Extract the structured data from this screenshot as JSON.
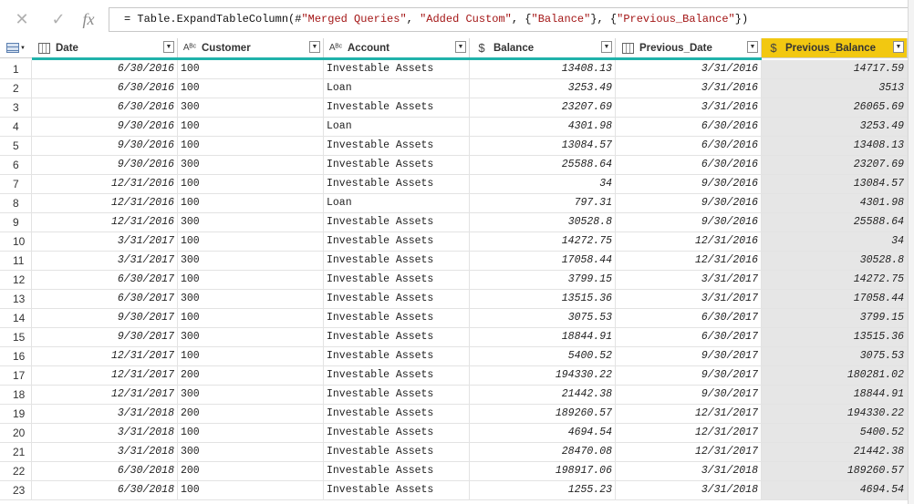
{
  "formula": {
    "prefix": "= Table.ExpandTableColumn(#",
    "arg1": "\"Merged Queries\"",
    "sep1": ", ",
    "arg2": "\"Added Custom\"",
    "sep2": ", {",
    "arg3": "\"Balance\"",
    "sep3": "}, {",
    "arg4": "\"Previous_Balance\"",
    "suffix": "})"
  },
  "columns": [
    {
      "label": "Date",
      "type_icon": "calendar-icon",
      "type_glyph": ""
    },
    {
      "label": "Customer",
      "type_icon": "text-type-icon",
      "type_glyph": "Aᴮᶜ"
    },
    {
      "label": "Account",
      "type_icon": "text-type-icon",
      "type_glyph": "Aᴮᶜ"
    },
    {
      "label": "Balance",
      "type_icon": "currency-icon",
      "type_glyph": "$"
    },
    {
      "label": "Previous_Date",
      "type_icon": "calendar-icon",
      "type_glyph": ""
    },
    {
      "label": "Previous_Balance",
      "type_icon": "currency-icon",
      "type_glyph": "$"
    }
  ],
  "rows": [
    [
      "1",
      "6/30/2016",
      "100",
      "Investable Assets",
      "13408.13",
      "3/31/2016",
      "14717.59"
    ],
    [
      "2",
      "6/30/2016",
      "100",
      "Loan",
      "3253.49",
      "3/31/2016",
      "3513"
    ],
    [
      "3",
      "6/30/2016",
      "300",
      "Investable Assets",
      "23207.69",
      "3/31/2016",
      "26065.69"
    ],
    [
      "4",
      "9/30/2016",
      "100",
      "Loan",
      "4301.98",
      "6/30/2016",
      "3253.49"
    ],
    [
      "5",
      "9/30/2016",
      "100",
      "Investable Assets",
      "13084.57",
      "6/30/2016",
      "13408.13"
    ],
    [
      "6",
      "9/30/2016",
      "300",
      "Investable Assets",
      "25588.64",
      "6/30/2016",
      "23207.69"
    ],
    [
      "7",
      "12/31/2016",
      "100",
      "Investable Assets",
      "34",
      "9/30/2016",
      "13084.57"
    ],
    [
      "8",
      "12/31/2016",
      "100",
      "Loan",
      "797.31",
      "9/30/2016",
      "4301.98"
    ],
    [
      "9",
      "12/31/2016",
      "300",
      "Investable Assets",
      "30528.8",
      "9/30/2016",
      "25588.64"
    ],
    [
      "10",
      "3/31/2017",
      "100",
      "Investable Assets",
      "14272.75",
      "12/31/2016",
      "34"
    ],
    [
      "11",
      "3/31/2017",
      "300",
      "Investable Assets",
      "17058.44",
      "12/31/2016",
      "30528.8"
    ],
    [
      "12",
      "6/30/2017",
      "100",
      "Investable Assets",
      "3799.15",
      "3/31/2017",
      "14272.75"
    ],
    [
      "13",
      "6/30/2017",
      "300",
      "Investable Assets",
      "13515.36",
      "3/31/2017",
      "17058.44"
    ],
    [
      "14",
      "9/30/2017",
      "100",
      "Investable Assets",
      "3075.53",
      "6/30/2017",
      "3799.15"
    ],
    [
      "15",
      "9/30/2017",
      "300",
      "Investable Assets",
      "18844.91",
      "6/30/2017",
      "13515.36"
    ],
    [
      "16",
      "12/31/2017",
      "100",
      "Investable Assets",
      "5400.52",
      "9/30/2017",
      "3075.53"
    ],
    [
      "17",
      "12/31/2017",
      "200",
      "Investable Assets",
      "194330.22",
      "9/30/2017",
      "180281.02"
    ],
    [
      "18",
      "12/31/2017",
      "300",
      "Investable Assets",
      "21442.38",
      "9/30/2017",
      "18844.91"
    ],
    [
      "19",
      "3/31/2018",
      "200",
      "Investable Assets",
      "189260.57",
      "12/31/2017",
      "194330.22"
    ],
    [
      "20",
      "3/31/2018",
      "100",
      "Investable Assets",
      "4694.54",
      "12/31/2017",
      "5400.52"
    ],
    [
      "21",
      "3/31/2018",
      "300",
      "Investable Assets",
      "28470.08",
      "12/31/2017",
      "21442.38"
    ],
    [
      "22",
      "6/30/2018",
      "200",
      "Investable Assets",
      "198917.06",
      "3/31/2018",
      "189260.57"
    ],
    [
      "23",
      "6/30/2018",
      "100",
      "Investable Assets",
      "1255.23",
      "3/31/2018",
      "4694.54"
    ]
  ],
  "colors": {
    "selected_header": "#f2c811",
    "accent_line": "#20b2aa",
    "selected_column": "#e6e6e6"
  }
}
